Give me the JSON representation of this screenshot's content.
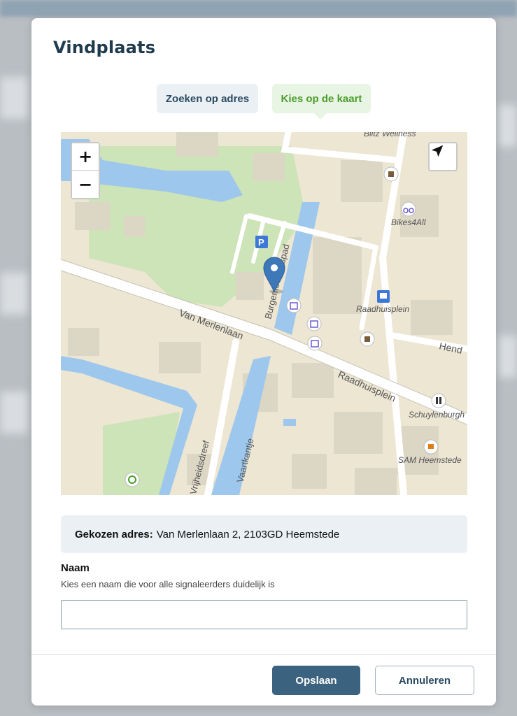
{
  "dialog": {
    "title": "Vindplaats"
  },
  "tabs": [
    {
      "label": "Zoeken op adres",
      "active": false
    },
    {
      "label": "Kies op de kaart",
      "active": true
    }
  ],
  "map": {
    "zoom_in": "+",
    "zoom_out": "−",
    "labels": {
      "blitz": "Blitz Wellness",
      "bikes": "Bikes4All",
      "burg": "Burgemeesterspad",
      "raadhuisplein_sq": "Raadhuisplein",
      "hend": "Hend",
      "van_merlenlaan": "Van Merlenlaan",
      "raadhuisplein_st": "Raadhuisplein",
      "schuylenburgh": "Schuylenburgh",
      "sam": "SAM Heemstede",
      "vrijheidsdreef": "Vrijheidsdreef",
      "vaartkantje": "Vaartkantje",
      "parking": "P"
    },
    "colors": {
      "land": "#ece6d3",
      "water": "#9dc7ec",
      "park": "#cde3b8",
      "road": "#ffffff",
      "building": "#dcd6c5",
      "marker": "#3d78b8"
    }
  },
  "address": {
    "label": "Gekozen adres:",
    "value": "Van Merlenlaan 2, 2103GD Heemstede"
  },
  "name_field": {
    "label": "Naam",
    "hint": "Kies een naam die voor alle signaleerders duidelijk is",
    "value": "",
    "placeholder": ""
  },
  "buttons": {
    "save": "Opslaan",
    "cancel": "Annuleren"
  }
}
